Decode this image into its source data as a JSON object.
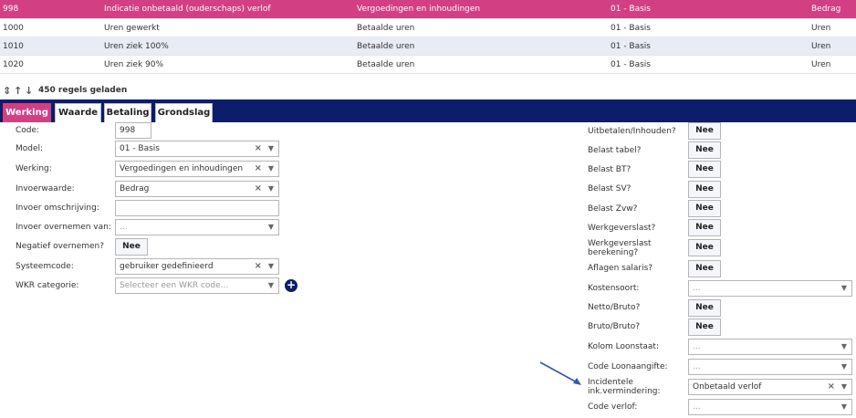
{
  "rows": [
    {
      "code": "998",
      "name": "Indicatie onbetaald (ouderschaps) verlof",
      "type": "Vergoedingen en inhoudingen",
      "model": "01 - Basis",
      "input": "Bedrag"
    },
    {
      "code": "1000",
      "name": "Uren gewerkt",
      "type": "Betaalde uren",
      "model": "01 - Basis",
      "input": "Uren"
    },
    {
      "code": "1010",
      "name": "Uren ziek 100%",
      "type": "Betaalde uren",
      "model": "01 - Basis",
      "input": "Uren"
    },
    {
      "code": "1020",
      "name": "Uren ziek 90%",
      "type": "Betaalde uren",
      "model": "01 - Basis",
      "input": "Uren"
    }
  ],
  "status": {
    "loaded": "450 regels geladen",
    "icons": [
      "sort-icon",
      "arrow-up-icon",
      "arrow-down-icon"
    ]
  },
  "tabs": [
    "Werking",
    "Waarde",
    "Betaling",
    "Grondslag"
  ],
  "left": {
    "code_label": "Code:",
    "code_value": "998",
    "model_label": "Model:",
    "model_value": "01 - Basis",
    "werking_label": "Werking:",
    "werking_value": "Vergoedingen en inhoudingen",
    "invoerwaarde_label": "Invoerwaarde:",
    "invoerwaarde_value": "Bedrag",
    "omschrijving_label": "Invoer omschrijving:",
    "omschrijving_value": "",
    "overnemen_label": "Invoer overnemen van:",
    "overnemen_placeholder": "...",
    "negatief_label": "Negatief overnemen?",
    "negatief_value": "Nee",
    "systeemcode_label": "Systeemcode:",
    "systeemcode_value": "gebruiker gedefinieerd",
    "wkr_label": "WKR categorie:",
    "wkr_placeholder": "Selecteer een WKR code..."
  },
  "right": {
    "uitbetalen_label": "Uitbetalen/Inhouden?",
    "uitbetalen_value": "Nee",
    "tabel_label": "Belast tabel?",
    "tabel_value": "Nee",
    "bt_label": "Belast BT?",
    "bt_value": "Nee",
    "sv_label": "Belast SV?",
    "sv_value": "Nee",
    "zvw_label": "Belast Zvw?",
    "zvw_value": "Nee",
    "werkgeverslast_label": "Werkgeverslast?",
    "werkgeverslast_value": "Nee",
    "wgl_berekening_label1": "Werkgeverslast",
    "wgl_berekening_label2": "berekening?",
    "wgl_berekening_value": "Nee",
    "aflagen_label": "Aflagen salaris?",
    "aflagen_value": "Nee",
    "kostensoort_label": "Kostensoort:",
    "kostensoort_placeholder": "...",
    "netto_label": "Netto/Bruto?",
    "netto_value": "Nee",
    "bruto_label": "Bruto/Bruto?",
    "bruto_value": "Nee",
    "kolom_label": "Kolom Loonstaat:",
    "kolom_placeholder": "...",
    "loonaangifte_label": "Code Loonaangifte:",
    "loonaangifte_placeholder": "...",
    "incidentele_label1": "Incidentele",
    "incidentele_label2": "ink.vermindering:",
    "incidentele_value": "Onbetaald verlof",
    "verlof_label": "Code verlof:",
    "verlof_placeholder": "..."
  },
  "colors": {
    "accent": "#d33f83",
    "navy": "#0b1d6b",
    "arrow": "#2f5aa8"
  }
}
